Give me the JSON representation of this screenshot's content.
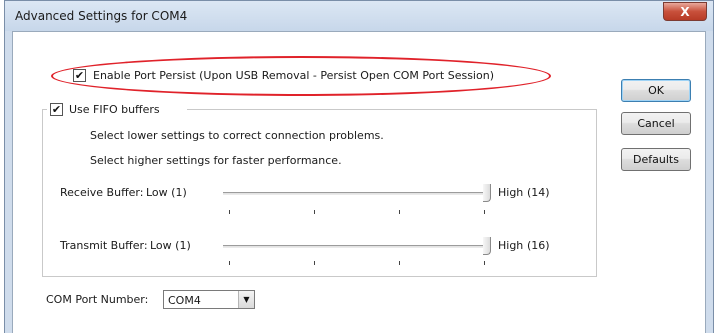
{
  "window": {
    "title": "Advanced Settings for COM4",
    "close_glyph": "X"
  },
  "port_persist": {
    "label": "Enable Port Persist (Upon USB Removal - Persist Open COM Port Session)",
    "checked": true
  },
  "fifo": {
    "label": "Use FIFO buffers",
    "checked": true,
    "hint_lower": "Select lower settings to correct connection problems.",
    "hint_higher": "Select higher settings for faster performance."
  },
  "receive_buffer": {
    "label": "Receive Buffer:",
    "low": "Low (1)",
    "high": "High",
    "value": "(14)",
    "level": 1.0
  },
  "transmit_buffer": {
    "label": "Transmit Buffer:",
    "low": "Low (1)",
    "high": "High",
    "value": "(16)",
    "level": 1.0
  },
  "com_port": {
    "label": "COM Port Number:",
    "selected": "COM4"
  },
  "buttons": {
    "ok": "OK",
    "cancel": "Cancel",
    "defaults": "Defaults"
  },
  "check_glyph": "✔",
  "colors": {
    "highlight": "#e0222a",
    "close_button": "#c8503b"
  }
}
